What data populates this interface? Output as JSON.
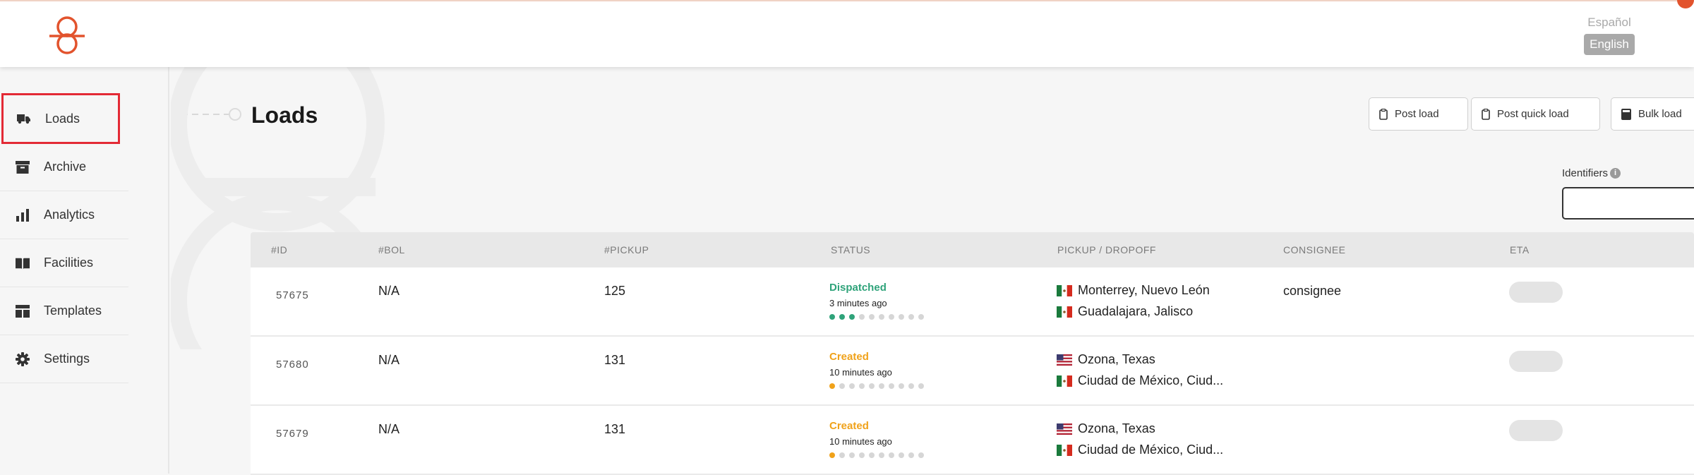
{
  "header": {
    "lang_es": "Español",
    "lang_en": "English"
  },
  "sidebar": {
    "items": [
      {
        "label": "Loads",
        "icon": "truck-icon",
        "active": true
      },
      {
        "label": "Archive",
        "icon": "archive-icon"
      },
      {
        "label": "Analytics",
        "icon": "bar-chart-icon"
      },
      {
        "label": "Facilities",
        "icon": "book-icon"
      },
      {
        "label": "Templates",
        "icon": "template-icon"
      },
      {
        "label": "Settings",
        "icon": "gear-icon"
      }
    ]
  },
  "main": {
    "title": "Loads",
    "buttons": {
      "post_load": "Post load",
      "post_quick_load": "Post quick load",
      "bulk_load": "Bulk load"
    },
    "identifiers_label": "Identifiers",
    "identifiers_value": ""
  },
  "table": {
    "columns": [
      "#ID",
      "#BOL",
      "#PICKUP",
      "STATUS",
      "PICKUP / DROPOFF",
      "CONSIGNEE",
      "ETA"
    ],
    "rows": [
      {
        "id": "57675",
        "bol": "N/A",
        "pickup": "125",
        "status": "Dispatched",
        "status_color": "#2fa37a",
        "ago": "3 minutes ago",
        "progress_steps": 3,
        "total_steps": 10,
        "pickup_loc": "Monterrey, Nuevo León",
        "pickup_flag": "mx",
        "dropoff_loc": "Guadalajara, Jalisco",
        "dropoff_flag": "mx",
        "consignee": "consignee"
      },
      {
        "id": "57680",
        "bol": "N/A",
        "pickup": "131",
        "status": "Created",
        "status_color": "#f0a21a",
        "ago": "10 minutes ago",
        "progress_steps": 1,
        "total_steps": 10,
        "pickup_loc": "Ozona, Texas",
        "pickup_flag": "us",
        "dropoff_loc": "Ciudad de México, Ciud...",
        "dropoff_flag": "mx",
        "consignee": ""
      },
      {
        "id": "57679",
        "bol": "N/A",
        "pickup": "131",
        "status": "Created",
        "status_color": "#f0a21a",
        "ago": "10 minutes ago",
        "progress_steps": 1,
        "total_steps": 10,
        "pickup_loc": "Ozona, Texas",
        "pickup_flag": "us",
        "dropoff_loc": "Ciudad de México, Ciud...",
        "dropoff_flag": "mx",
        "consignee": ""
      }
    ]
  },
  "colors": {
    "brand": "#e2532d",
    "dispatched": "#2fa37a",
    "created": "#f0a21a",
    "highlight": "#e32a35"
  }
}
